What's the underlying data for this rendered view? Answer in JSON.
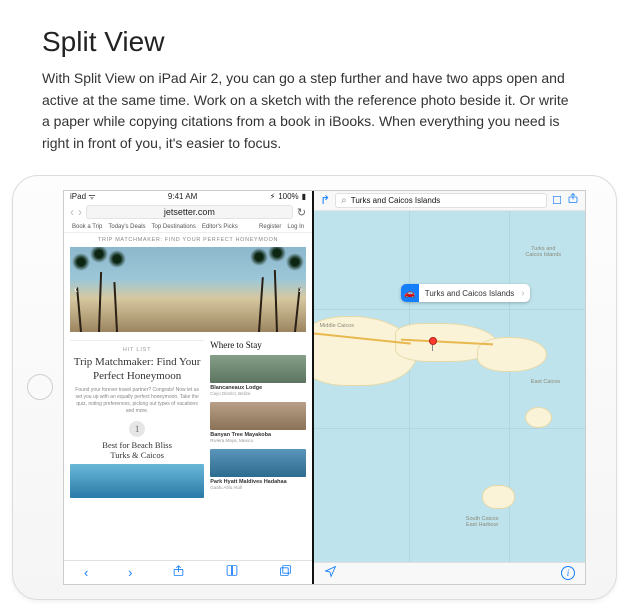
{
  "heading": "Split View",
  "body": "With Split View on iPad Air 2, you can go a step further and have two apps open and active at the same time. Work on a sketch with the reference photo beside it. Or write a paper while copying citations from a book in iBooks. When everything you need is right in front of you, it's easier to focus.",
  "ipad": {
    "status": {
      "carrier": "iPad",
      "time": "9:41 AM",
      "battery": "100%"
    },
    "safari": {
      "url": "jetsetter.com",
      "nav_back": "‹",
      "nav_fwd": "›",
      "siteNav": {
        "left": [
          "Book a Trip",
          "Today's Deals",
          "Top Destinations",
          "Editor's Picks"
        ],
        "right": [
          "Register",
          "Log In"
        ]
      },
      "kicker": "TRIP MATCHMAKER: FIND YOUR PERFECT HONEYMOON",
      "article": {
        "hitlist": "HIT LIST",
        "title_l1": "Trip Matchmaker: Find Your",
        "title_l2": "Perfect Honeymoon",
        "dek": "Found your forever travel partner? Congrats! Now let us set you up with an equally perfect honeymoon. Take the quiz, noting preferences, picking out types of vacations and more.",
        "num": "1",
        "list_line1": "Best for Beach Bliss",
        "list_line2": "Turks & Caicos"
      },
      "sidebar": {
        "heading": "Where to Stay",
        "cards": [
          {
            "title": "Blancaneaux Lodge",
            "subtitle": "Cayo District, Belize"
          },
          {
            "title": "Banyan Tree Mayakoba",
            "subtitle": "Riviera Maya, Mexico"
          },
          {
            "title": "Park Hyatt Maldives Hadahaa",
            "subtitle": "Gaafu Alifu Atoll"
          }
        ]
      },
      "toolbar_icons": [
        "back",
        "forward",
        "share",
        "bookmarks",
        "tabs"
      ]
    },
    "maps": {
      "query": "Turks and Caicos Islands",
      "callout": "Turks and Caicos Islands",
      "labels": {
        "main": "Turks and\nCaicos Islands",
        "middle": "Middle Caicos",
        "east": "East Caicos",
        "south": "South Caicos\nEast Harbour"
      }
    }
  }
}
